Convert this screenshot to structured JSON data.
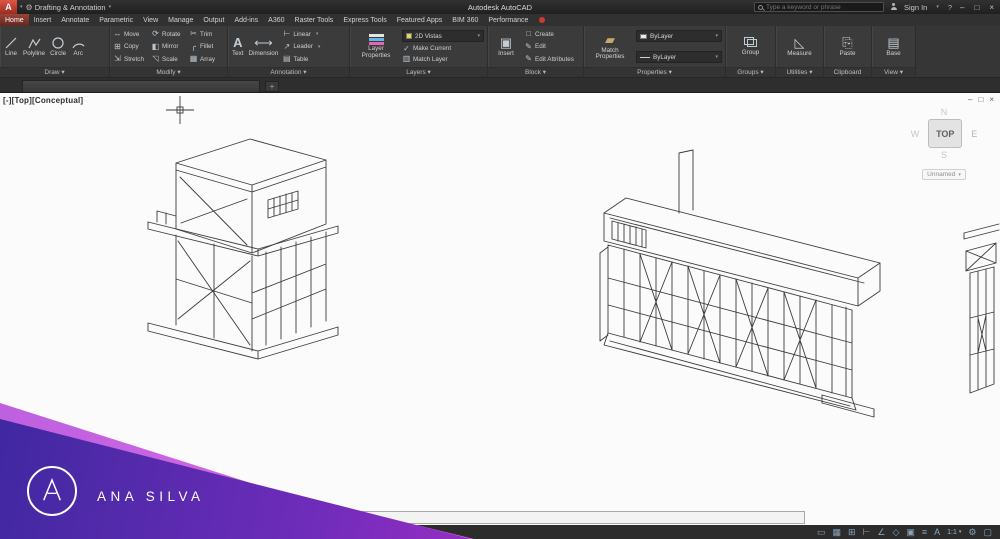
{
  "titlebar": {
    "logo_letter": "A",
    "workspace": "Drafting & Annotation",
    "app_title": "Autodesk AutoCAD",
    "search_placeholder": "Type a keyword or phrase",
    "sign_in": "Sign In",
    "help": "?",
    "minimize": "–",
    "restore": "□",
    "close": "×"
  },
  "ribbon": {
    "tabs": [
      "Home",
      "Insert",
      "Annotate",
      "Parametric",
      "View",
      "Manage",
      "Output",
      "Add-ins",
      "A360",
      "Raster Tools",
      "Express Tools",
      "Featured Apps",
      "BIM 360",
      "Performance"
    ],
    "draw": {
      "label": "Draw ▾",
      "items": [
        "Line",
        "Polyline",
        "Circle",
        "Arc"
      ]
    },
    "modify": {
      "label": "Modify ▾",
      "items": [
        "Move",
        "Rotate",
        "Trim",
        "Copy",
        "Mirror",
        "Fillet",
        "Stretch",
        "Scale",
        "Array"
      ]
    },
    "annotation": {
      "label": "Annotation ▾",
      "text": "Text",
      "dimension": "Dimension",
      "items": [
        "Linear",
        "Leader",
        "Table"
      ]
    },
    "layers": {
      "label": "Layers ▾",
      "big": "Layer Properties",
      "state": "2D Vistas",
      "items": [
        "Make Current",
        "Match Layer"
      ]
    },
    "block": {
      "label": "Block ▾",
      "big": "Insert",
      "items": [
        "Create",
        "Edit",
        "Edit Attributes"
      ]
    },
    "properties": {
      "label": "Properties ▾",
      "big": "Match Properties",
      "rows": [
        "ByLayer",
        "ByLayer"
      ]
    },
    "groups": {
      "label": "Groups ▾",
      "big": "Group"
    },
    "utilities": {
      "label": "Utilities ▾",
      "big": "Measure"
    },
    "clipboard": {
      "label": "Clipboard",
      "big": "Paste"
    },
    "view": {
      "label": "View ▾",
      "big": "Base"
    }
  },
  "filetabs": {
    "add": "+"
  },
  "viewport": {
    "label": "[-][Top][Conceptual]",
    "viewcube": {
      "top": "TOP",
      "n": "N",
      "w": "W",
      "e": "E",
      "s": "S"
    },
    "views": "Unnamed",
    "minimize": "–",
    "restore": "□",
    "close": "×"
  },
  "statusbar": {
    "scale": "1:1"
  },
  "watermark": {
    "brand": "ANA SILVA"
  },
  "colors": {
    "titlebar": "#262626",
    "ribbon": "#3b3b3b",
    "active_tab": "#8a3b30",
    "accent_red": "#c23b2e",
    "canvas": "#fbfbfb",
    "status_icon": "#87a5bd",
    "watermark_start": "#33279a",
    "watermark_mid": "#c631cf",
    "watermark_end": "#ff41d9"
  }
}
